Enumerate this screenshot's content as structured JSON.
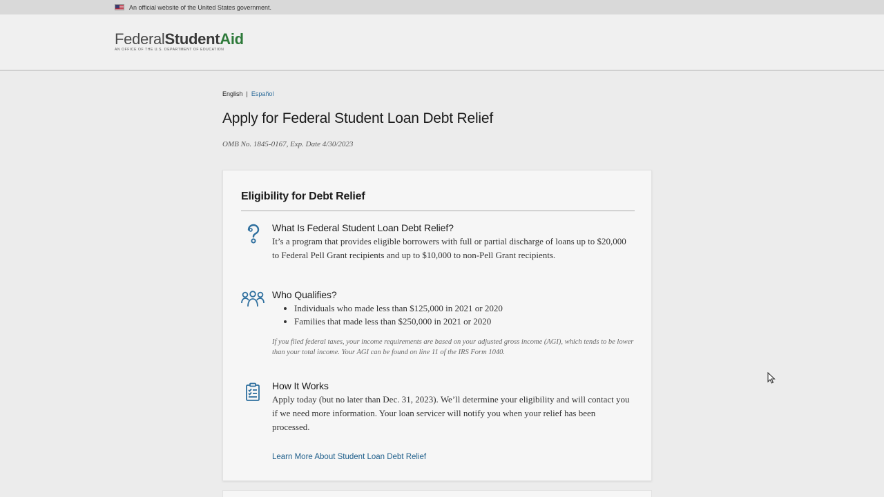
{
  "gov_banner": {
    "text": "An official website of the United States government.",
    "flag_icon": "us-flag-icon"
  },
  "header": {
    "logo": {
      "word1": "Federal",
      "word2": "Student",
      "word3": "Aid",
      "tagline": "An Office of the U.S. Department of Education"
    }
  },
  "language": {
    "current": "English",
    "separator": "|",
    "alternate": "Español"
  },
  "page": {
    "title": "Apply for Federal Student Loan Debt Relief",
    "omb": "OMB No. 1845-0167, Exp. Date 4/30/2023"
  },
  "card": {
    "title": "Eligibility for Debt Relief",
    "sections": [
      {
        "icon": "question-mark-icon",
        "heading": "What Is Federal Student Loan Debt Relief?",
        "text": "It’s a program that provides eligible borrowers with full or partial discharge of loans up to $20,000 to Federal Pell Grant recipients and up to $10,000 to non-Pell Grant recipients."
      },
      {
        "icon": "people-group-icon",
        "heading": "Who Qualifies?",
        "items": [
          "Individuals who made less than $125,000 in 2021 or 2020",
          "Families that made less than $250,000 in 2021 or 2020"
        ],
        "note": "If you filed federal taxes, your income requirements are based on your adjusted gross income (AGI), which tends to be lower than your total income. Your AGI can be found on line 11 of the IRS Form 1040."
      },
      {
        "icon": "clipboard-checklist-icon",
        "heading": "How It Works",
        "text": "Apply today (but no later than Dec. 31, 2023). We’ll determine your eligibility and will contact you if we need more information. Your loan servicer will notify you when your relief has been processed."
      }
    ],
    "learn_more": "Learn More About Student Loan Debt Relief"
  },
  "colors": {
    "accent_link": "#1f5f8b",
    "icon_blue": "#2e6f9e",
    "logo_green": "#2e7a3a",
    "page_bg": "#ececec"
  }
}
